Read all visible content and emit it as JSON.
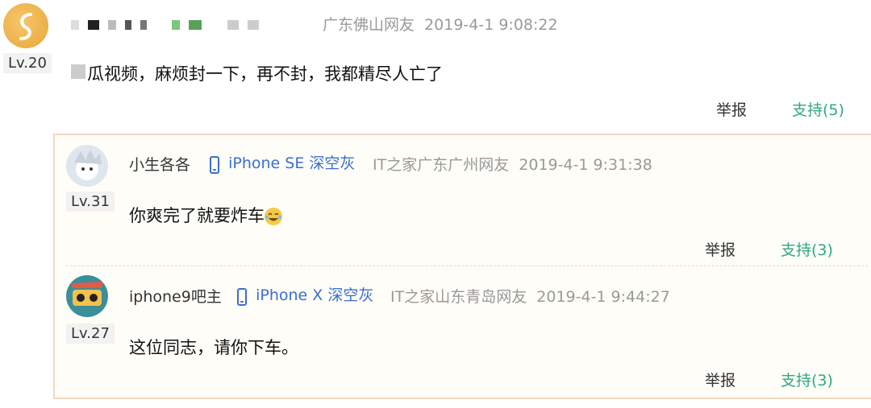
{
  "main_comment": {
    "level": "Lv.20",
    "location": "广东佛山网友",
    "timestamp": "2019-4-1 9:08:22",
    "content": "瓜视频，麻烦封一下，再不封，我都精尽人亡了",
    "report_label": "举报",
    "support_label": "支持(5)"
  },
  "replies": [
    {
      "username": "小生各各",
      "device": "iPhone SE 深空灰",
      "location": "IT之家广东广州网友",
      "timestamp": "2019-4-1 9:31:38",
      "level": "Lv.31",
      "content": "你爽完了就要炸车",
      "report_label": "举报",
      "support_label": "支持(3)"
    },
    {
      "username": "iphone9吧主",
      "device": "iPhone X 深空灰",
      "location": "IT之家山东青岛网友",
      "timestamp": "2019-4-1 9:44:27",
      "level": "Lv.27",
      "content": "这位同志，请你下车。",
      "report_label": "举报",
      "support_label": "支持(3)"
    }
  ],
  "colors": {
    "accent_support": "#2fa881",
    "device_blue": "#3a6fd1",
    "reply_border": "#f3d9c2"
  }
}
